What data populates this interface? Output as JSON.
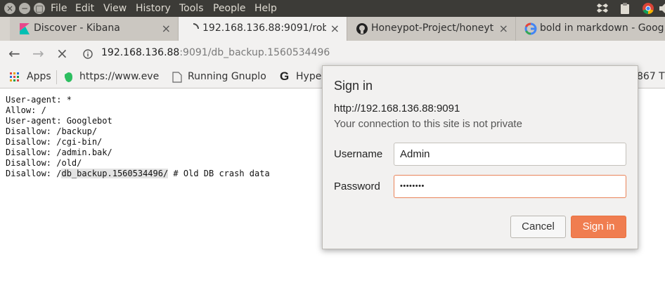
{
  "menubar": {
    "items": [
      "File",
      "Edit",
      "View",
      "History",
      "Tools",
      "People",
      "Help"
    ],
    "window_buttons": [
      "×",
      "−",
      "□"
    ]
  },
  "tabs": [
    {
      "title": "Discover - Kibana",
      "icon": "kibana-icon"
    },
    {
      "title": "192.168.136.88:9091/robo",
      "icon": "loading-spinner-icon",
      "active": true
    },
    {
      "title": "Honeypot-Project/honeyt",
      "icon": "github-icon"
    },
    {
      "title": "bold in markdown - Googl",
      "icon": "google-icon"
    }
  ],
  "address": {
    "host": "192.168.136.88",
    "rest": ":9091/db_backup.1560534496"
  },
  "bookmarks": {
    "apps": "Apps",
    "items": [
      "https://www.eve",
      "Running Gnuplo",
      "Hype",
      "867 T"
    ]
  },
  "page_text": {
    "lines": [
      "User-agent: *",
      "Allow: /",
      "User-agent: Googlebot",
      "Disallow: /backup/",
      "Disallow: /cgi-bin/",
      "Disallow: /admin.bak/",
      "Disallow: /old/"
    ],
    "last_prefix": "Disallow: /",
    "last_highlight": "db_backup.1560534496/",
    "last_suffix": " # Old DB crash data"
  },
  "dialog": {
    "title": "Sign in",
    "host": "http://192.168.136.88:9091",
    "warning": "Your connection to this site is not private",
    "username_label": "Username",
    "username_value": "Admin",
    "password_label": "Password",
    "password_value": "••••••••",
    "cancel_label": "Cancel",
    "signin_label": "Sign in"
  },
  "colors": {
    "accent": "#f07d50",
    "menubar_bg": "#3c3b37"
  }
}
